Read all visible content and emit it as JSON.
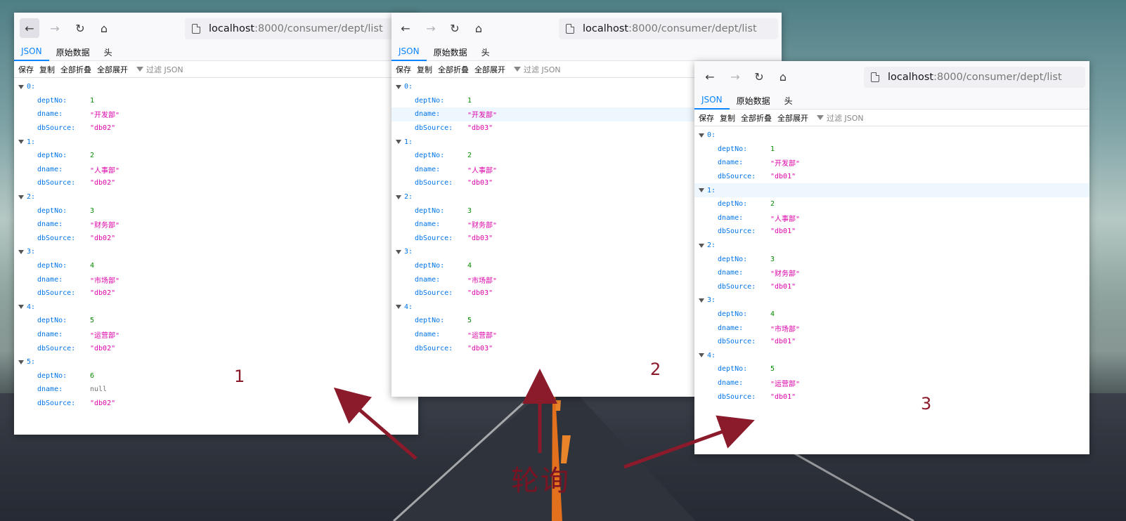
{
  "browser": {
    "url_host": "localhost",
    "url_path": ":8000/consumer/dept/list",
    "tabs": [
      "JSON",
      "原始数据",
      "头"
    ],
    "actions": [
      "保存",
      "复制",
      "全部折叠",
      "全部展开"
    ],
    "filter_placeholder": "过滤 JSON",
    "nav_icons": [
      "back-arrow-icon",
      "forward-arrow-icon",
      "reload-icon",
      "home-icon",
      "page-icon"
    ]
  },
  "windows": [
    {
      "items": [
        {
          "index": "0:",
          "deptNo": "1",
          "dname": "\"开发部\"",
          "dbSource": "\"db02\""
        },
        {
          "index": "1:",
          "deptNo": "2",
          "dname": "\"人事部\"",
          "dbSource": "\"db02\""
        },
        {
          "index": "2:",
          "deptNo": "3",
          "dname": "\"财务部\"",
          "dbSource": "\"db02\""
        },
        {
          "index": "3:",
          "deptNo": "4",
          "dname": "\"市场部\"",
          "dbSource": "\"db02\""
        },
        {
          "index": "4:",
          "deptNo": "5",
          "dname": "\"运营部\"",
          "dbSource": "\"db02\""
        },
        {
          "index": "5:",
          "deptNo": "6",
          "dname": "null",
          "dbSource": "\"db02\""
        }
      ]
    },
    {
      "items": [
        {
          "index": "0:",
          "deptNo": "1",
          "dname": "\"开发部\"",
          "dbSource": "\"db03\""
        },
        {
          "index": "1:",
          "deptNo": "2",
          "dname": "\"人事部\"",
          "dbSource": "\"db03\""
        },
        {
          "index": "2:",
          "deptNo": "3",
          "dname": "\"财务部\"",
          "dbSource": "\"db03\""
        },
        {
          "index": "3:",
          "deptNo": "4",
          "dname": "\"市场部\"",
          "dbSource": "\"db03\""
        },
        {
          "index": "4:",
          "deptNo": "5",
          "dname": "\"运营部\"",
          "dbSource": "\"db03\""
        }
      ]
    },
    {
      "items": [
        {
          "index": "0:",
          "deptNo": "1",
          "dname": "\"开发部\"",
          "dbSource": "\"db01\""
        },
        {
          "index": "1:",
          "deptNo": "2",
          "dname": "\"人事部\"",
          "dbSource": "\"db01\""
        },
        {
          "index": "2:",
          "deptNo": "3",
          "dname": "\"财务部\"",
          "dbSource": "\"db01\""
        },
        {
          "index": "3:",
          "deptNo": "4",
          "dname": "\"市场部\"",
          "dbSource": "\"db01\""
        },
        {
          "index": "4:",
          "deptNo": "5",
          "dname": "\"运营部\"",
          "dbSource": "\"db01\""
        }
      ]
    }
  ],
  "keys": {
    "deptNo": "deptNo:",
    "dname": "dname:",
    "dbSource": "dbSource:"
  },
  "annotations": {
    "labels": [
      "1",
      "2",
      "3"
    ],
    "caption": "轮询",
    "color": "#8b1a2b"
  }
}
